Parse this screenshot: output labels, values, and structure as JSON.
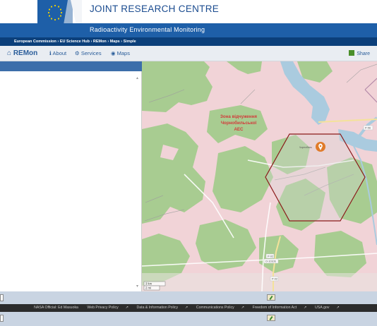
{
  "header": {
    "logo_line1": "European",
    "logo_line2": "Commission",
    "title": "JOINT RESEARCH CENTRE",
    "subtitle": "Radioactivity Environmental Monitoring"
  },
  "breadcrumb": "European Commission › EU Science Hub › REMon › Maps › Simple",
  "nav": {
    "brand": "REMon",
    "about": "About",
    "services": "Services",
    "maps": "Maps",
    "share": "Share"
  },
  "map": {
    "zone_label_1": "Зона відчуження",
    "zone_label_2": "Чорнобильської",
    "zone_label_3": "АЕС",
    "marker_place": "Чорнобиль",
    "road_p56": "P-56",
    "road_p02": "P-02",
    "road_p02_alt": "O-10106",
    "road_p02b": "P-02",
    "scale_km": "3 km",
    "scale_mi": "2 mi"
  },
  "footer": {
    "official": "NASA Official: Ed Masuoka",
    "links": [
      "Web Privacy Policy",
      "Data & Information Policy",
      "Communications Policy",
      "Freedom of Information Act",
      "USA.gov"
    ]
  },
  "colors": {
    "header_blue": "#1e5fa8",
    "crumb_blue": "#0b3f7a",
    "hex_stroke": "#8b1a1a",
    "marker": "#e07b2a",
    "forest": "#a8cc91",
    "farmland": "#f1d3d7"
  }
}
